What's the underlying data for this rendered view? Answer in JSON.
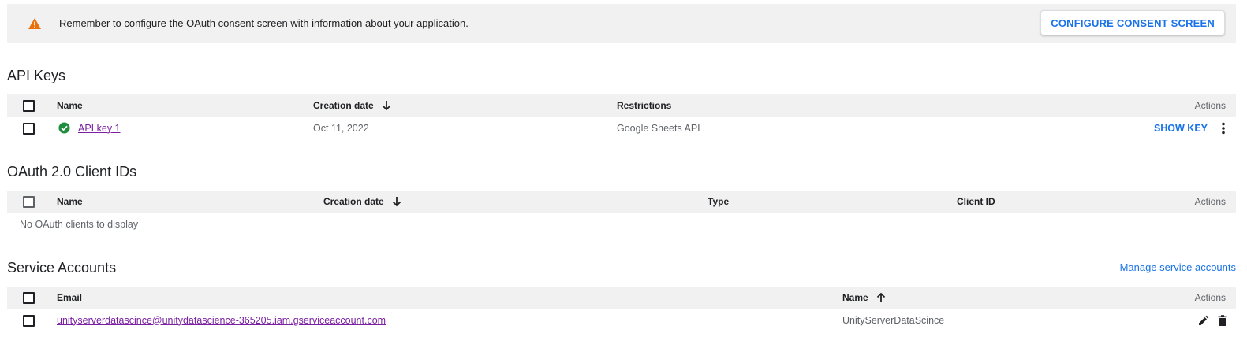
{
  "banner": {
    "message": "Remember to configure the OAuth consent screen with information about your application.",
    "button_label": "CONFIGURE CONSENT SCREEN",
    "icon": "warning-icon",
    "icon_color": "#e8710a"
  },
  "api_keys": {
    "title": "API Keys",
    "columns": {
      "name": "Name",
      "creation_date": "Creation date",
      "restrictions": "Restrictions",
      "actions": "Actions"
    },
    "rows": [
      {
        "name": "API key 1",
        "creation_date": "Oct 11, 2022",
        "restrictions": "Google Sheets API",
        "action_label": "SHOW KEY",
        "status_icon": "check-circle-icon",
        "status_color": "#1e8e3e"
      }
    ]
  },
  "oauth": {
    "title": "OAuth 2.0 Client IDs",
    "columns": {
      "name": "Name",
      "creation_date": "Creation date",
      "type": "Type",
      "client_id": "Client ID",
      "actions": "Actions"
    },
    "empty_message": "No OAuth clients to display"
  },
  "service_accounts": {
    "title": "Service Accounts",
    "manage_link": "Manage service accounts",
    "columns": {
      "email": "Email",
      "name": "Name",
      "actions": "Actions"
    },
    "rows": [
      {
        "email": "unityserverdatascince@unitydatascience-365205.iam.gserviceaccount.com",
        "name": "UnityServerDataScince"
      }
    ]
  },
  "colors": {
    "accent": "#1a73e8",
    "visited_link": "#7b1fa2",
    "header_bg": "#f1f1f1"
  }
}
